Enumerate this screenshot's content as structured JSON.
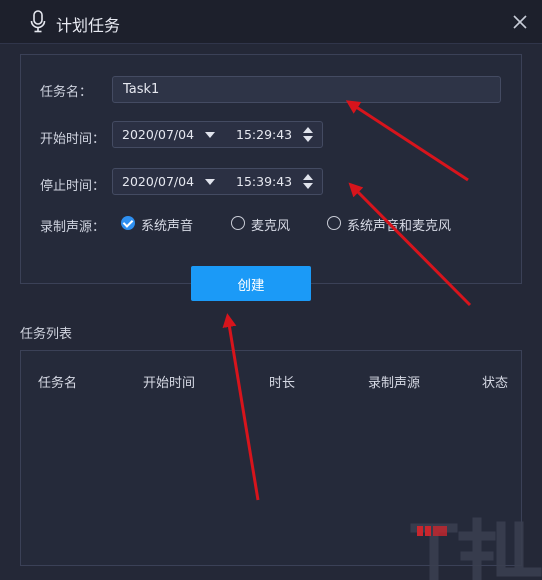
{
  "window": {
    "title": "计划任务",
    "mic_icon": "microphone-icon",
    "close_icon": "close-icon"
  },
  "form": {
    "task_name_label": "任务名：",
    "task_name_value": "Task1",
    "start_label": "开始时间：",
    "start_date": "2020/07/04",
    "start_time": "15:29:43",
    "stop_label": "停止时间：",
    "stop_date": "2020/07/04",
    "stop_time": "15:39:43",
    "source_label": "录制声源：",
    "sources": [
      {
        "label": "系统声音",
        "checked": true
      },
      {
        "label": "麦克风",
        "checked": false
      },
      {
        "label": "系统声音和麦克风",
        "checked": false
      }
    ],
    "create_label": "创建"
  },
  "task_list": {
    "title": "任务列表",
    "columns": [
      "任务名",
      "开始时间",
      "时长",
      "录制声源",
      "状态"
    ],
    "rows": []
  },
  "colors": {
    "accent": "#1b9af7",
    "background": "#242837",
    "annotation_arrow": "#d7141c"
  }
}
